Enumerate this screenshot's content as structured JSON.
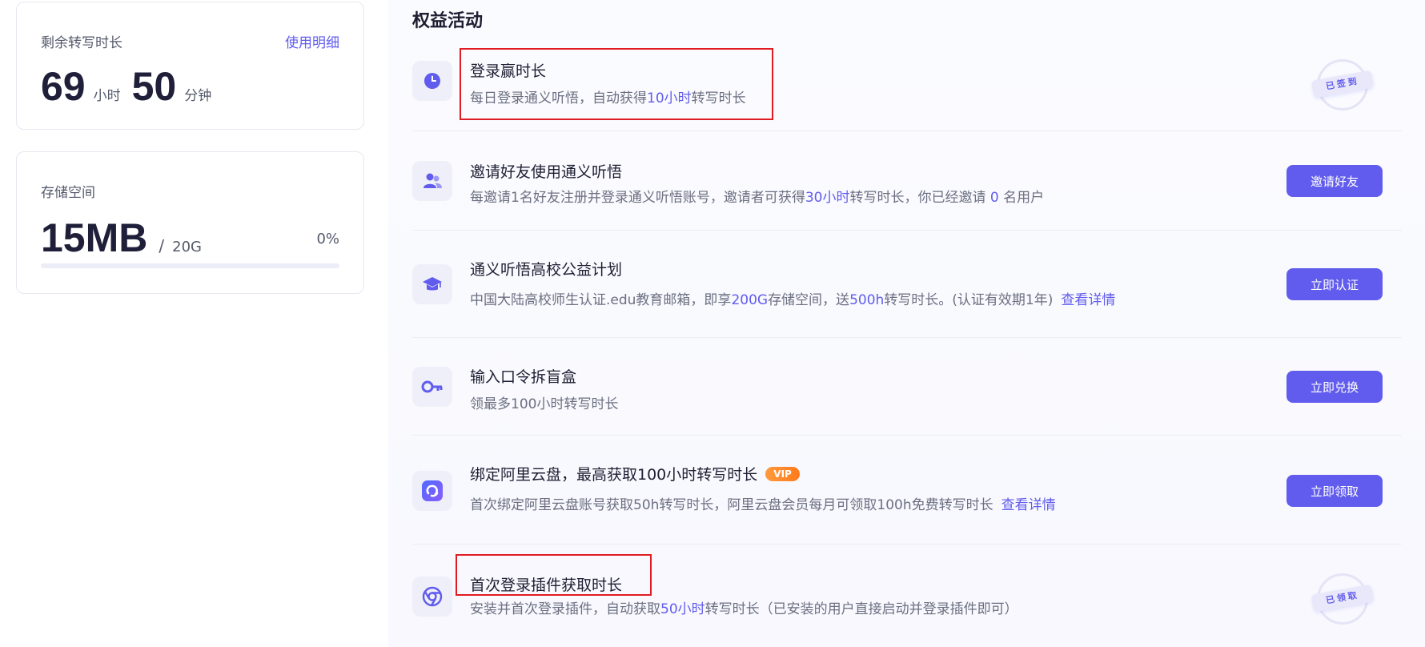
{
  "transcription": {
    "title": "剩余转写时长",
    "details_link": "使用明细",
    "hours": "69",
    "hours_unit": "小时",
    "minutes": "50",
    "minutes_unit": "分钟"
  },
  "storage": {
    "title": "存储空间",
    "used": "15MB",
    "separator": "/",
    "capacity": "20G",
    "percent": "0%",
    "percent_value": 0
  },
  "benefits": {
    "title": "权益活动",
    "items": [
      {
        "icon": "clock-icon",
        "title": "登录赢时长",
        "desc_pre": "每日登录通义听悟，自动获得",
        "desc_hl": "10小时",
        "desc_post": "转写时长",
        "status_stamp": "已签到"
      },
      {
        "icon": "users-icon",
        "title": "邀请好友使用通义听悟",
        "desc_pre": "每邀请1名好友注册并登录通义听悟账号，邀请者可获得",
        "desc_hl": "30小时",
        "desc_mid": "转写时长，你已经邀请 ",
        "desc_hl2": "0",
        "desc_post": " 名用户",
        "button": "邀请好友"
      },
      {
        "icon": "graduation-cap-icon",
        "title": "通义听悟高校公益计划",
        "desc_pre": "中国大陆高校师生认证.edu教育邮箱，即享",
        "desc_hl": "200G",
        "desc_mid": "存储空间，送",
        "desc_hl2": "500h",
        "desc_post": "转写时长。(认证有效期1年)",
        "link": "查看详情",
        "button": "立即认证"
      },
      {
        "icon": "key-icon",
        "title": "输入口令拆盲盒",
        "desc": "领最多100小时转写时长",
        "button": "立即兑换"
      },
      {
        "icon": "aliyun-drive-icon",
        "title": "绑定阿里云盘，最高获取100小时转写时长",
        "badge": "VIP",
        "desc": "首次绑定阿里云盘账号获取50h转写时长，阿里云盘会员每月可领取100h免费转写时长",
        "link": "查看详情",
        "button": "立即领取"
      },
      {
        "icon": "chrome-icon",
        "title": "首次登录插件获取时长",
        "desc_pre": "安装并首次登录插件，自动获取",
        "desc_hl": "50小时",
        "desc_post": "转写时长（已安装的用户直接启动并登录插件即可）",
        "status_stamp": "已领取"
      }
    ]
  },
  "colors": {
    "accent": "#615ced",
    "highlight_box": "#e11b22",
    "vip_badge": "#ff8a2a"
  }
}
